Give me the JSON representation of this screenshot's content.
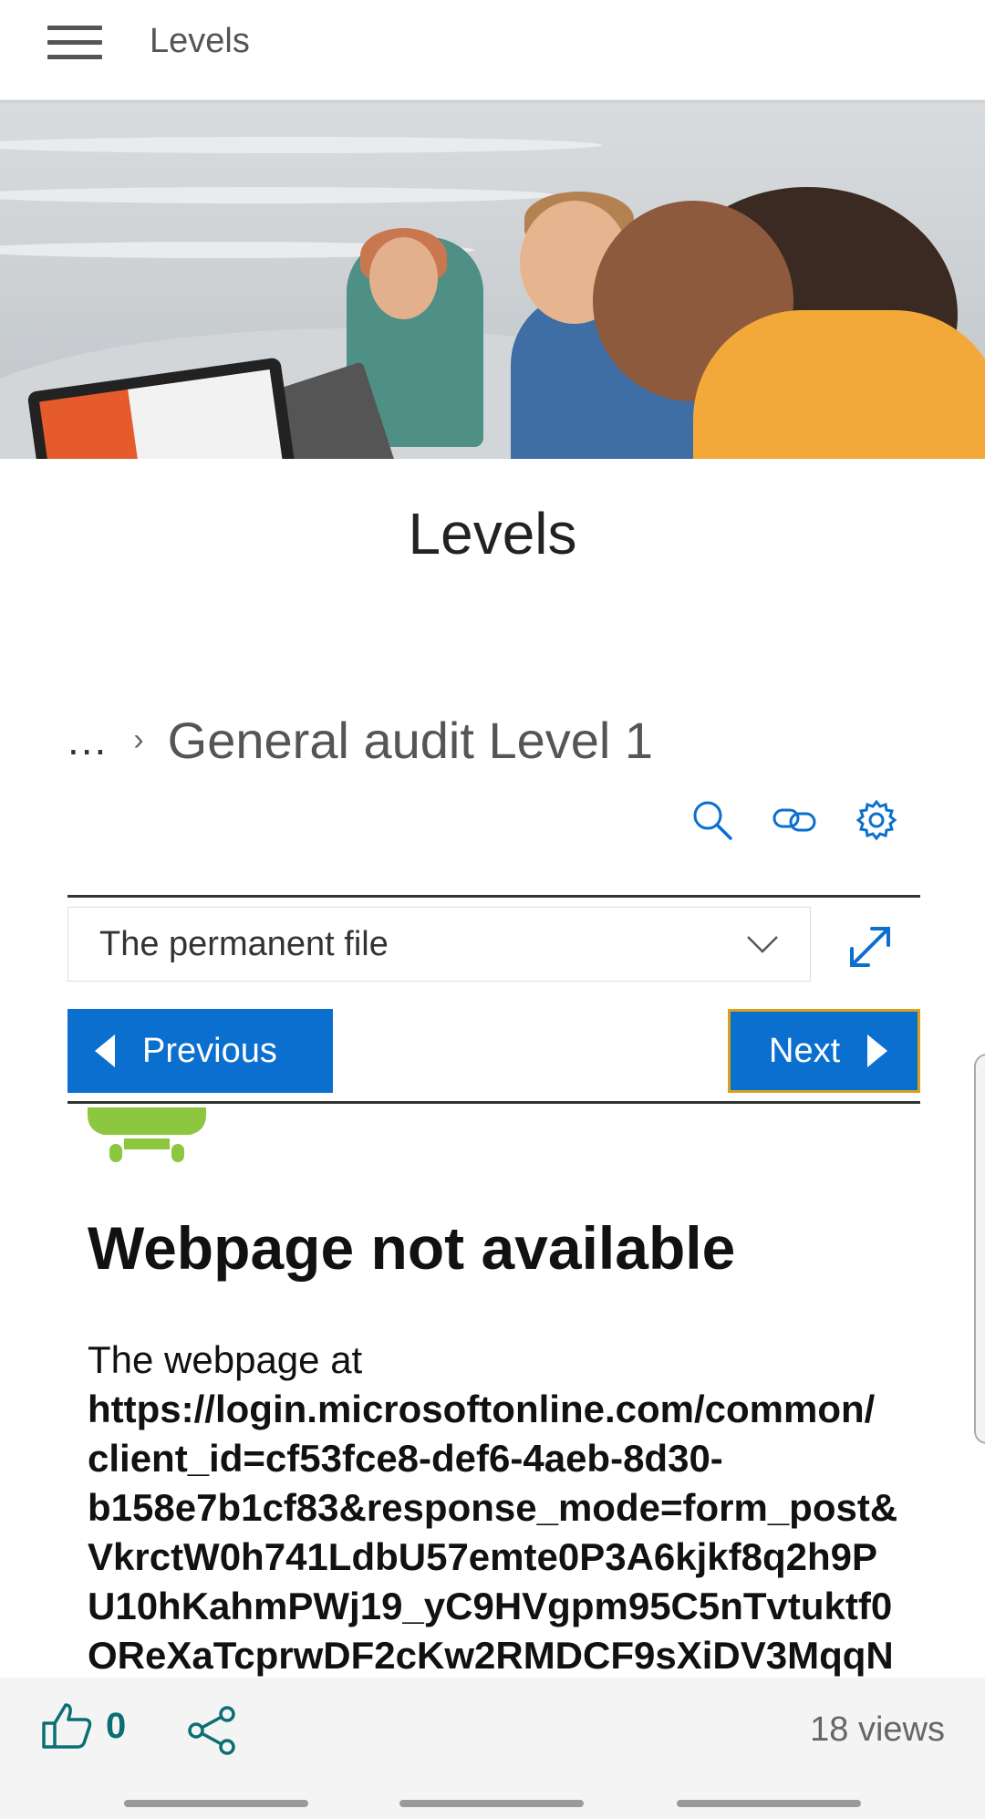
{
  "appbar": {
    "title": "Levels"
  },
  "page": {
    "title": "Levels"
  },
  "breadcrumb": {
    "ellipsis": "...",
    "separator": "›",
    "current": "General audit Level 1"
  },
  "toolbar": {
    "icons": [
      "search-icon",
      "link-icon",
      "gear-icon"
    ]
  },
  "selector": {
    "value": "The permanent file"
  },
  "nav": {
    "previous": "Previous",
    "next": "Next"
  },
  "webview": {
    "title": "Webpage not available",
    "intro": "The webpage at",
    "url_lines": [
      "https://login.microsoftonline.com/common/",
      "client_id=cf53fce8-def6-4aeb-8d30-",
      "b158e7b1cf83&response_mode=form_post&",
      "VkrctW0h741LdbU57emte0P3A6kjkf8q2h9P",
      "U10hKahmPWj19_yC9HVgpm95C5nTvtuktf0",
      "OReXaTcprwDF2cKw2RMDCF9sXiDV3MqqN"
    ]
  },
  "footer": {
    "likes": "0",
    "views": "18 views"
  },
  "colors": {
    "accent": "#0b6fd0",
    "teal": "#0a6f74",
    "next_border": "#d7a21a"
  }
}
